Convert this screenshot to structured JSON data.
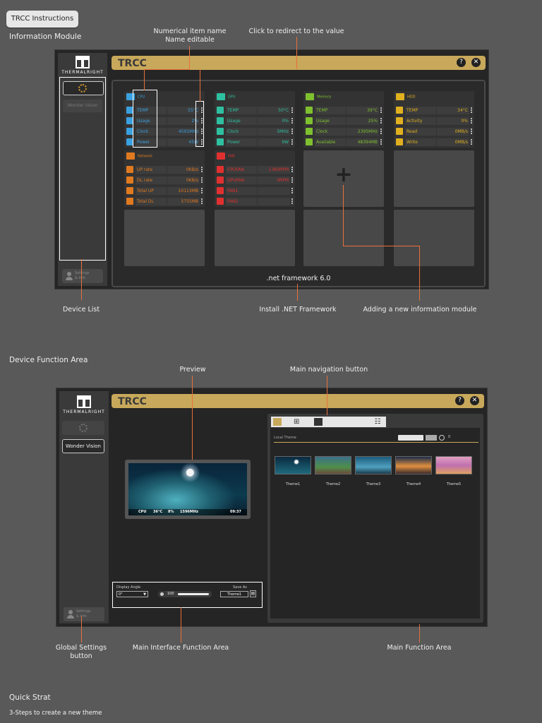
{
  "top_button": "TRCC Instructions",
  "sections": {
    "info_module": "Information Module",
    "device_function": "Device Function Area",
    "quick_start": "Quick Strat",
    "quick_start_sub": "3-Steps to create a new theme"
  },
  "annotations1": {
    "numerical_item": "Numerical item name",
    "name_editable": "Name editable",
    "click_redirect": "Click to redirect to the value",
    "device_list": "Device List",
    "install_net": "Install .NET Framework",
    "adding_module": "Adding a new information module"
  },
  "annotations2": {
    "preview": "Preview",
    "main_nav": "Main navigation button",
    "global_settings_1": "Global Settings",
    "global_settings_2": "button",
    "main_interface": "Main Interface Function Area",
    "main_function": "Main Function Area"
  },
  "app": {
    "brand": "THERMALRIGHT",
    "title": "TRCC",
    "help": "?",
    "close": "✕",
    "net_framework": ".net framework 6.0",
    "add_symbol": "+",
    "sidebar_item_dim": "Wonder Vision",
    "sidebar_item": "Wonder Vision",
    "settings_text_1": "Settings",
    "settings_text_2": "& Info"
  },
  "modules": {
    "cpu": {
      "title": "CPU",
      "color": "#3aa0e0",
      "rows": [
        {
          "name": "TEMP",
          "value": "55°C"
        },
        {
          "name": "Usage",
          "value": "2%"
        },
        {
          "name": "Clock",
          "value": "4591MHz"
        },
        {
          "name": "Power",
          "value": "45W"
        }
      ]
    },
    "gpu": {
      "title": "GPU",
      "color": "#2ec0a0",
      "rows": [
        {
          "name": "TEMP",
          "value": "50°C"
        },
        {
          "name": "Usage",
          "value": "0%"
        },
        {
          "name": "Clock",
          "value": "5MHz"
        },
        {
          "name": "Power",
          "value": "9W"
        }
      ]
    },
    "memory": {
      "title": "Memory",
      "color": "#7ec02e",
      "rows": [
        {
          "name": "TEMP",
          "value": "39°C"
        },
        {
          "name": "Usage",
          "value": "25%"
        },
        {
          "name": "Clock",
          "value": "2395MHz"
        },
        {
          "name": "Available",
          "value": "48394MB"
        }
      ]
    },
    "hdd": {
      "title": "HDD",
      "color": "#e0b020",
      "rows": [
        {
          "name": "TEMP",
          "value": "34°C"
        },
        {
          "name": "Activity",
          "value": "0%"
        },
        {
          "name": "Read",
          "value": "0MB/s"
        },
        {
          "name": "Write",
          "value": "0MB/s"
        }
      ]
    },
    "network": {
      "title": "Network",
      "color": "#e07a20",
      "rows": [
        {
          "name": "UP rate",
          "value": "0KB/s"
        },
        {
          "name": "DL rate",
          "value": "0KB/s"
        },
        {
          "name": "Total UP",
          "value": "10113MB"
        },
        {
          "name": "Total DL",
          "value": "5755MB"
        }
      ]
    },
    "fan": {
      "title": "FAN",
      "color": "#e03030",
      "rows": [
        {
          "name": "CPUFAN",
          "value": "1360RPM"
        },
        {
          "name": "GPUFAN",
          "value": "0RPM"
        },
        {
          "name": "FAN1",
          "value": ""
        },
        {
          "name": "FAN2",
          "value": ""
        }
      ]
    }
  },
  "device_area": {
    "preview_stats": [
      "CPU",
      "36°C",
      "8%",
      "1596MHz"
    ],
    "preview_time": "09:37",
    "local_theme": "Local Theme",
    "counter": "0",
    "themes": [
      "Theme1",
      "Theme2",
      "Theme3",
      "Theme4",
      "Theme5"
    ],
    "display_angle_label": "Display Angle",
    "display_angle_value": "0°",
    "brightness": "100",
    "save_as_label": "Save As",
    "save_as_value": "Theme1"
  },
  "colors": {
    "accent": "#c8a85a",
    "annotation_line": "#e8703a"
  }
}
